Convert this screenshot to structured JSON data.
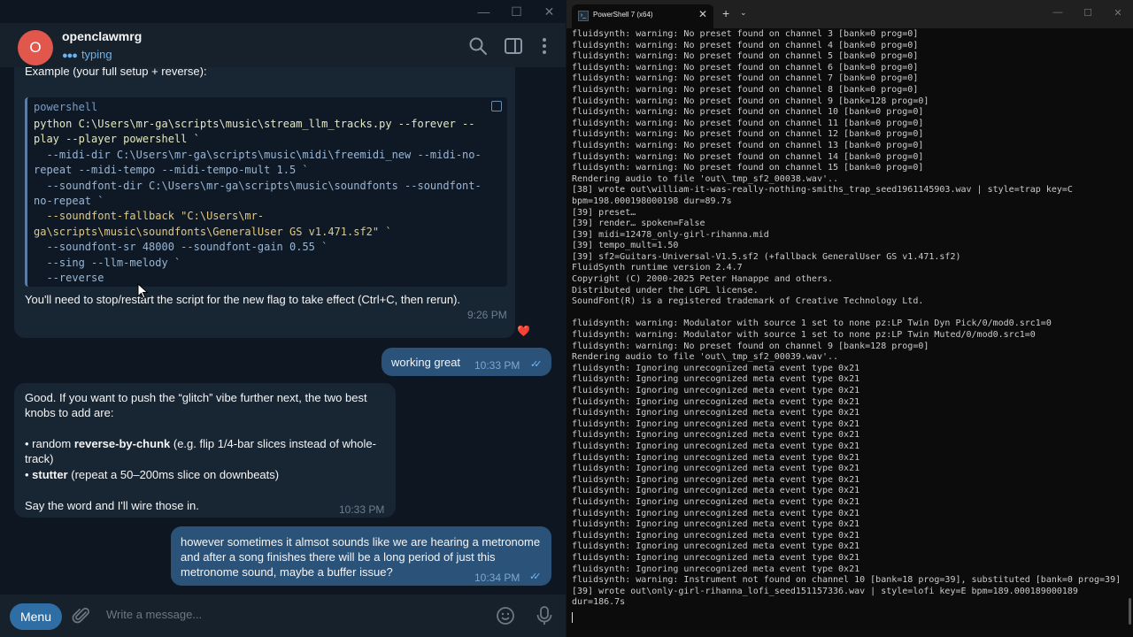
{
  "telegram": {
    "window_controls": [
      "—",
      "☐",
      "✕"
    ],
    "chat": {
      "name": "openclawmrg",
      "avatar_letter": "O",
      "status": "typing",
      "avatar_color": "#e2574c",
      "accent_color": "#6ab3f3"
    },
    "header_icons": [
      "search-icon",
      "sidebar-toggle-icon",
      "more-vertical-icon"
    ],
    "messages": [
      {
        "direction": "in",
        "intro": "Example (your full setup + reverse):",
        "code_lang": "powershell",
        "code_lines": [
          "python C:\\Users\\mr-ga\\scripts\\music\\stream_llm_tracks.py --forever --play --player powershell `",
          "  --midi-dir C:\\Users\\mr-ga\\scripts\\music\\midi\\freemidi_new --midi-no-repeat --midi-tempo --midi-tempo-mult 1.5 `",
          "  --soundfont-dir C:\\Users\\mr-ga\\scripts\\music\\soundfonts --soundfont-no-repeat `",
          "  --soundfont-fallback \"C:\\Users\\mr-ga\\scripts\\music\\soundfonts\\GeneralUser GS v1.471.sf2\" `",
          "  --soundfont-sr 48000 --soundfont-gain 0.55 `",
          "  --sing --llm-melody `",
          "  --reverse"
        ],
        "outro": "You'll need to stop/restart the script for the new flag to take effect (Ctrl+C, then rerun).",
        "time": "9:26 PM",
        "reaction": "❤️"
      },
      {
        "direction": "out",
        "text": "working great",
        "time": "10:33 PM",
        "ticks": "✓✓"
      },
      {
        "direction": "in",
        "line1": "Good. If you want to push the “glitch” vibe further next, the two best knobs to add are:",
        "bullet1_prefix": "• random ",
        "bullet1_bold": "reverse-by-chunk",
        "bullet1_rest": " (e.g. flip 1/4-bar slices instead of whole-track)",
        "bullet2_prefix": "• ",
        "bullet2_bold": "stutter",
        "bullet2_rest": " (repeat a 50–200ms slice on downbeats)",
        "closing": "Say the word and I'll wire those in.",
        "time": "10:33 PM"
      },
      {
        "direction": "out",
        "text": "however sometimes it almsot sounds like we are hearing a metronome and after a song finishes there will be a long period of just this metronome sound, maybe a buffer issue?",
        "time": "10:34 PM",
        "ticks": "✓✓"
      }
    ],
    "input": {
      "menu_label": "Menu",
      "placeholder": "Write a message..."
    }
  },
  "terminal": {
    "tab_title": "PowerShell 7 (x64)",
    "tab_close": "✕",
    "new_tab": "+",
    "dropdown": "⌄",
    "window_controls": [
      "—",
      "☐",
      "✕"
    ],
    "lines": [
      "fluidsynth: warning: No preset found on channel 3 [bank=0 prog=0]",
      "fluidsynth: warning: No preset found on channel 4 [bank=0 prog=0]",
      "fluidsynth: warning: No preset found on channel 5 [bank=0 prog=0]",
      "fluidsynth: warning: No preset found on channel 6 [bank=0 prog=0]",
      "fluidsynth: warning: No preset found on channel 7 [bank=0 prog=0]",
      "fluidsynth: warning: No preset found on channel 8 [bank=0 prog=0]",
      "fluidsynth: warning: No preset found on channel 9 [bank=128 prog=0]",
      "fluidsynth: warning: No preset found on channel 10 [bank=0 prog=0]",
      "fluidsynth: warning: No preset found on channel 11 [bank=0 prog=0]",
      "fluidsynth: warning: No preset found on channel 12 [bank=0 prog=0]",
      "fluidsynth: warning: No preset found on channel 13 [bank=0 prog=0]",
      "fluidsynth: warning: No preset found on channel 14 [bank=0 prog=0]",
      "fluidsynth: warning: No preset found on channel 15 [bank=0 prog=0]",
      "Rendering audio to file 'out\\_tmp_sf2_00038.wav'..",
      "[38] wrote out\\william-it-was-really-nothing-smiths_trap_seed1961145903.wav | style=trap key=C bpm=198.000198000198 dur=89.7s",
      "[39] preset…",
      "[39] render… spoken=False",
      "[39] midi=12478_only-girl-rihanna.mid",
      "[39] tempo_mult=1.50",
      "[39] sf2=Guitars-Universal-V1.5.sf2 (+fallback GeneralUser GS v1.471.sf2)",
      "FluidSynth runtime version 2.4.7",
      "Copyright (C) 2000-2025 Peter Hanappe and others.",
      "Distributed under the LGPL license.",
      "SoundFont(R) is a registered trademark of Creative Technology Ltd.",
      "",
      "fluidsynth: warning: Modulator with source 1 set to none pz:LP Twin Dyn Pick/0/mod0.src1=0",
      "fluidsynth: warning: Modulator with source 1 set to none pz:LP Twin Muted/0/mod0.src1=0",
      "fluidsynth: warning: No preset found on channel 9 [bank=128 prog=0]",
      "Rendering audio to file 'out\\_tmp_sf2_00039.wav'..",
      "fluidsynth: Ignoring unrecognized meta event type 0x21",
      "fluidsynth: Ignoring unrecognized meta event type 0x21",
      "fluidsynth: Ignoring unrecognized meta event type 0x21",
      "fluidsynth: Ignoring unrecognized meta event type 0x21",
      "fluidsynth: Ignoring unrecognized meta event type 0x21",
      "fluidsynth: Ignoring unrecognized meta event type 0x21",
      "fluidsynth: Ignoring unrecognized meta event type 0x21",
      "fluidsynth: Ignoring unrecognized meta event type 0x21",
      "fluidsynth: Ignoring unrecognized meta event type 0x21",
      "fluidsynth: Ignoring unrecognized meta event type 0x21",
      "fluidsynth: Ignoring unrecognized meta event type 0x21",
      "fluidsynth: Ignoring unrecognized meta event type 0x21",
      "fluidsynth: Ignoring unrecognized meta event type 0x21",
      "fluidsynth: Ignoring unrecognized meta event type 0x21",
      "fluidsynth: Ignoring unrecognized meta event type 0x21",
      "fluidsynth: Ignoring unrecognized meta event type 0x21",
      "fluidsynth: Ignoring unrecognized meta event type 0x21",
      "fluidsynth: Ignoring unrecognized meta event type 0x21",
      "fluidsynth: Ignoring unrecognized meta event type 0x21",
      "fluidsynth: warning: Instrument not found on channel 10 [bank=18 prog=39], substituted [bank=0 prog=39]",
      "[39] wrote out\\only-girl-rihanna_lofi_seed151157336.wav | style=lofi key=E bpm=189.000189000189 dur=186.7s"
    ]
  }
}
